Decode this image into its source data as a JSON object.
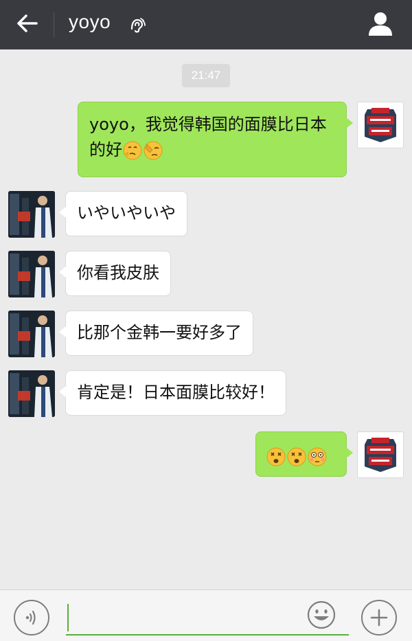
{
  "header": {
    "title": "yoyo",
    "back_icon": "arrow-left-icon",
    "earpiece_icon": "earpiece-mode-icon",
    "profile_icon": "person-icon"
  },
  "chat": {
    "timestamp": "21:47",
    "messages": [
      {
        "from": "me",
        "text": "yoyo，我觉得韩国的面膜比日本的好",
        "emojis": [
          "thinking-face-emoji",
          "facepalm-emoji"
        ]
      },
      {
        "from": "them",
        "text": "いやいやいや"
      },
      {
        "from": "them",
        "text": "你看我皮肤"
      },
      {
        "from": "them",
        "text": "比那个金韩一要好多了"
      },
      {
        "from": "them",
        "text": "肯定是！日本面膜比较好！"
      },
      {
        "from": "me",
        "text": "",
        "emojis": [
          "dizzy-face-emoji",
          "dizzy-face-emoji",
          "flushed-face-emoji"
        ]
      }
    ]
  },
  "input_bar": {
    "voice_icon": "voice-input-icon",
    "text_value": "",
    "emoji_icon": "smiley-icon",
    "more_icon": "plus-icon"
  },
  "colors": {
    "header_bg": "#393a3f",
    "chat_bg": "#ebebeb",
    "my_bubble": "#9fe65a",
    "their_bubble": "#ffffff",
    "input_accent": "#55b03a"
  }
}
